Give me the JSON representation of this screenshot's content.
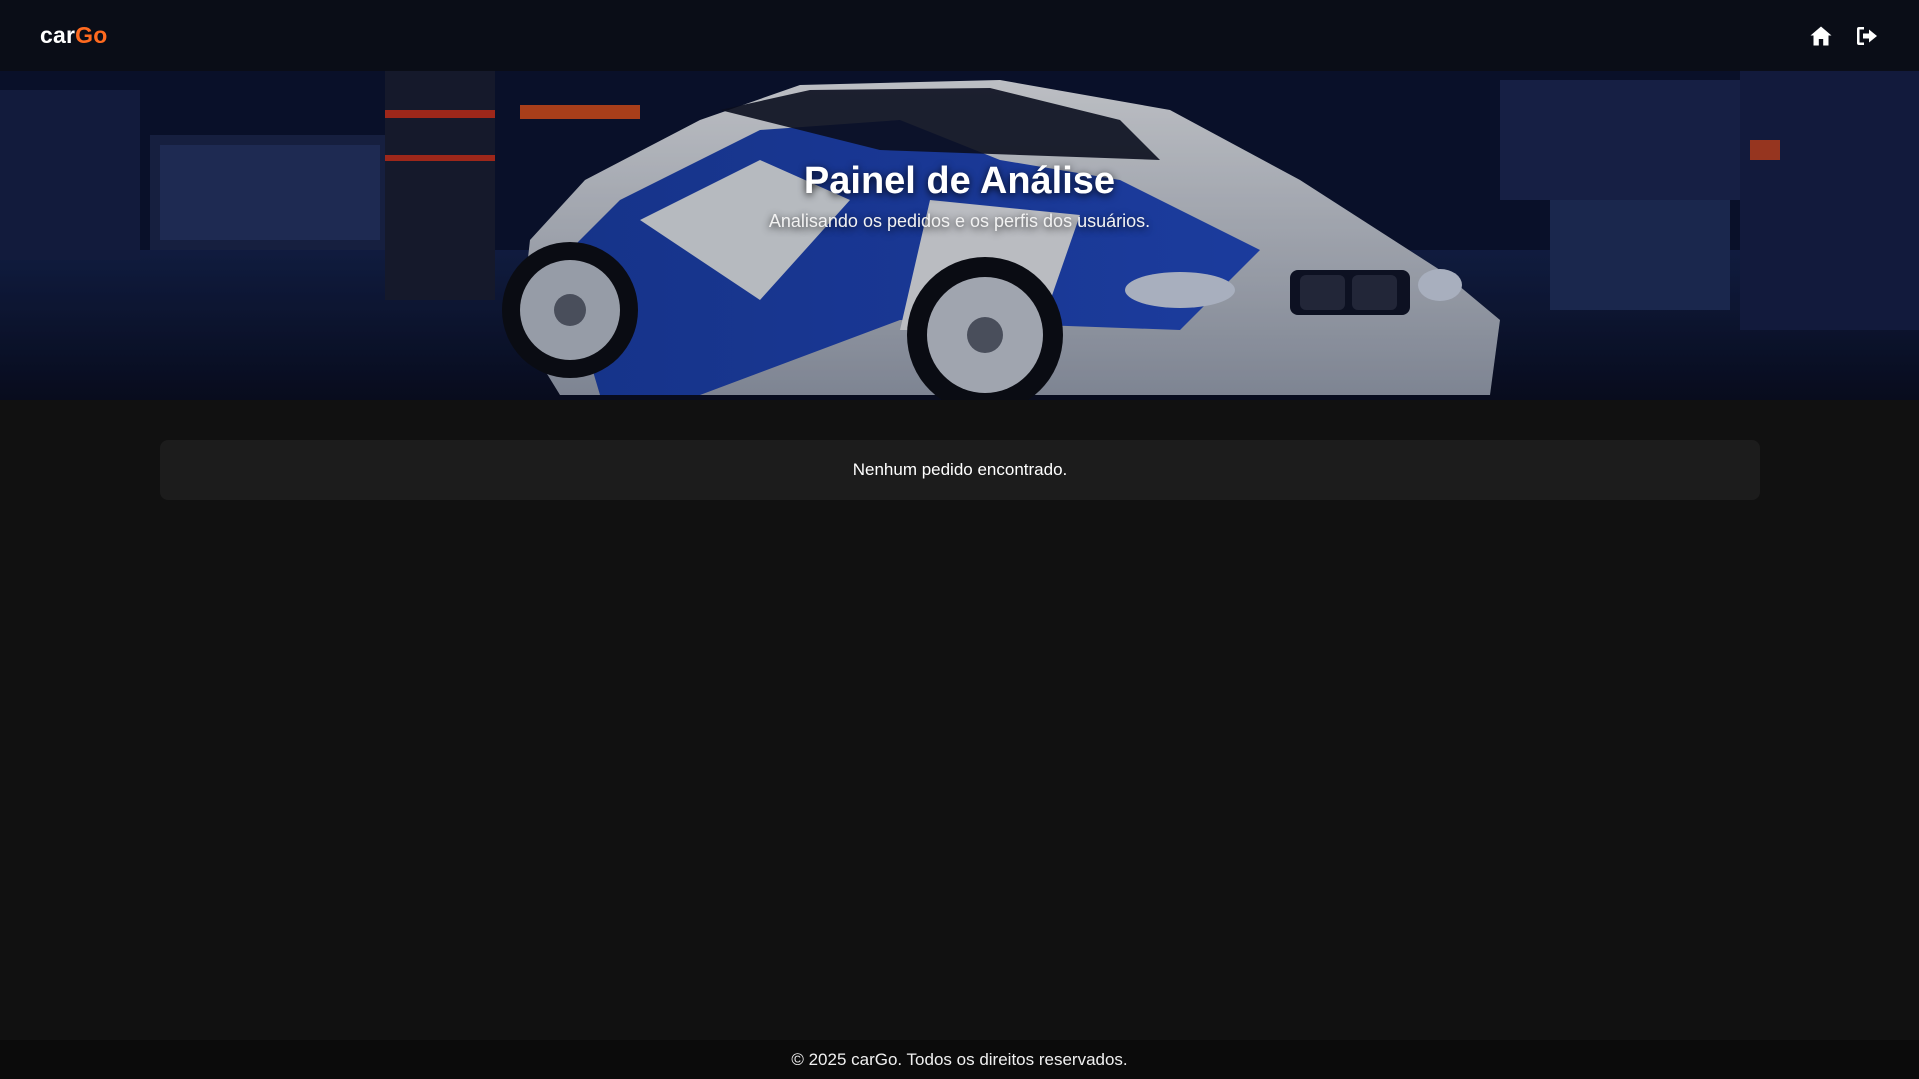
{
  "navbar": {
    "logo_part1": "car",
    "logo_part2": "Go",
    "home_icon": "home-icon",
    "logout_icon": "sign-out-icon"
  },
  "hero": {
    "title": "Painel de Análise",
    "subtitle": "Analisando os pedidos e os perfis dos usuários."
  },
  "orders": {
    "empty_message": "Nenhum pedido encontrado."
  },
  "footer": {
    "text": "© 2025 carGo. Todos os direitos reservados."
  },
  "colors": {
    "background": "#111111",
    "accent": "#ff6a1f",
    "card": "#1c1c1c",
    "footer": "#0b0b0b"
  }
}
